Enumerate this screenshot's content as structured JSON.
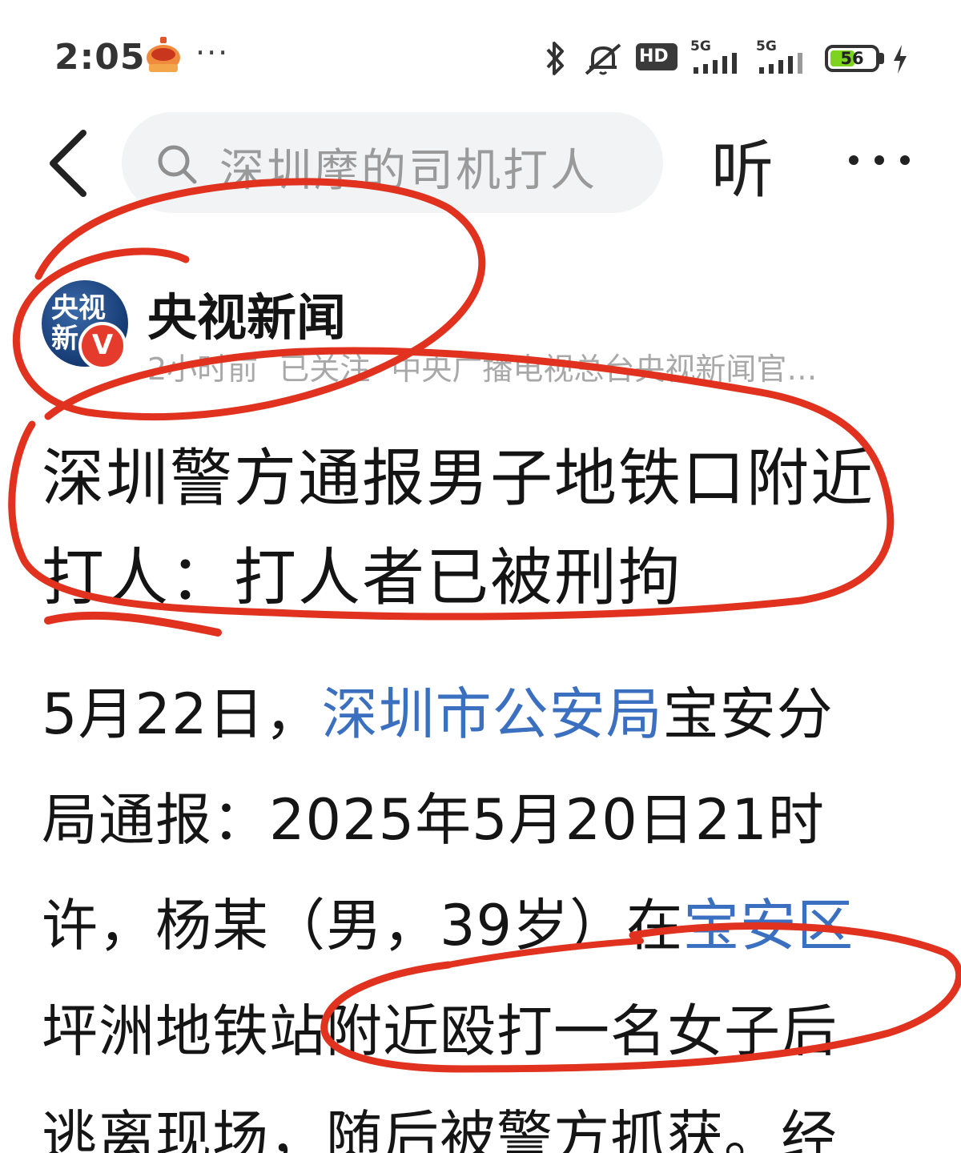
{
  "status_bar": {
    "time": "2:05",
    "more": "···",
    "network1": "5G",
    "network2": "5G",
    "hd_label": "HD",
    "battery_percent": "56",
    "battery_level": 0.56
  },
  "nav": {
    "search_placeholder": "深圳摩的司机打人",
    "listen_label": "听"
  },
  "author": {
    "avatar_text": "央视新",
    "verified_mark": "V",
    "name": "央视新闻",
    "time_ago": "2小时前",
    "follow_state": "已关注",
    "description": "中央广播电视总台央视新闻官…"
  },
  "article": {
    "headline_line1": "深圳警方通报男子地铁口附近",
    "headline_line2": "打人：打人者已被刑拘",
    "body": {
      "line1_a": "5月22日，",
      "line1_link": "深圳市公安局",
      "line1_b": "宝安分",
      "line2": "局通报：2025年5月20日21时",
      "line3_a": "许，杨某（男，39岁）在",
      "line3_link": "宝安区",
      "line4": "坪洲地铁站附近殴打一名女子后",
      "line5": "逃离现场，随后被警方抓获。经"
    }
  },
  "colors": {
    "link": "#3b6fc0",
    "annotation": "#e0321f",
    "verified": "#e53b2c",
    "battery": "#7ed321"
  }
}
